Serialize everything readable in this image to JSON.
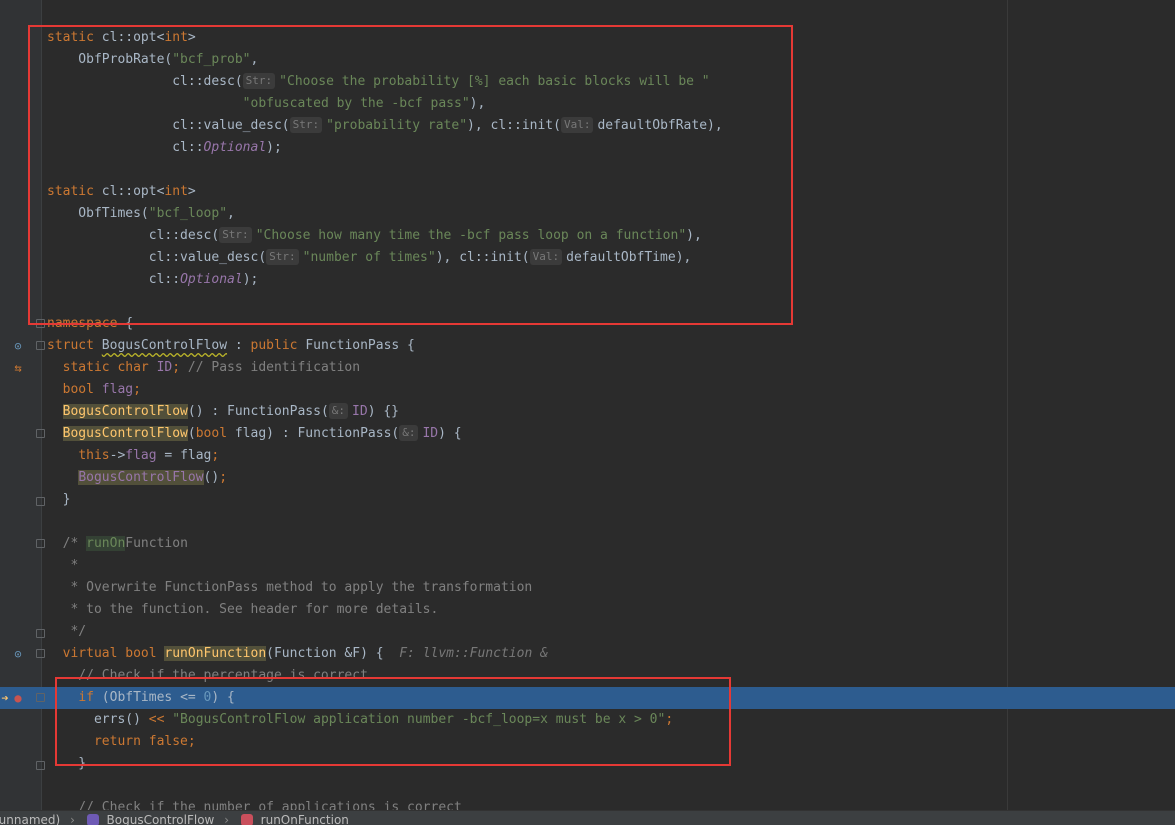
{
  "editor": {
    "lines": [
      {
        "id": "l1",
        "tokens": [
          {
            "c": "kw",
            "t": "static "
          },
          {
            "t": "cl::opt<"
          },
          {
            "c": "kw",
            "t": "int"
          },
          {
            "t": ">"
          }
        ]
      },
      {
        "id": "l2",
        "tokens": [
          {
            "t": "    ObfProbRate("
          },
          {
            "c": "str",
            "t": "\"bcf_prob\""
          },
          {
            "t": ","
          }
        ]
      },
      {
        "id": "l3",
        "tokens": [
          {
            "t": "                cl::desc("
          },
          {
            "c": "hint",
            "t": "Str:"
          },
          {
            "c": "str",
            "t": "\"Choose the probability [%] each basic blocks will be \""
          }
        ]
      },
      {
        "id": "l4",
        "tokens": [
          {
            "t": "                         "
          },
          {
            "c": "str",
            "t": "\"obfuscated by the -bcf pass\""
          },
          {
            "t": "),"
          }
        ]
      },
      {
        "id": "l5",
        "tokens": [
          {
            "t": "                cl::value_desc("
          },
          {
            "c": "hint",
            "t": "Str:"
          },
          {
            "c": "str",
            "t": "\"probability rate\""
          },
          {
            "t": "), cl::init("
          },
          {
            "c": "hint",
            "t": "Val:"
          },
          {
            "t": "defaultObfRate),"
          }
        ]
      },
      {
        "id": "l6",
        "tokens": [
          {
            "t": "                cl::"
          },
          {
            "c": "ital",
            "t": "Optional"
          },
          {
            "t": ");"
          }
        ]
      },
      {
        "id": "l7",
        "tokens": []
      },
      {
        "id": "l8",
        "tokens": [
          {
            "c": "kw",
            "t": "static "
          },
          {
            "t": "cl::opt<"
          },
          {
            "c": "kw",
            "t": "int"
          },
          {
            "t": ">"
          }
        ]
      },
      {
        "id": "l9",
        "tokens": [
          {
            "t": "    ObfTimes("
          },
          {
            "c": "str",
            "t": "\"bcf_loop\""
          },
          {
            "t": ","
          }
        ]
      },
      {
        "id": "l10",
        "tokens": [
          {
            "t": "             cl::desc("
          },
          {
            "c": "hint",
            "t": "Str:"
          },
          {
            "c": "str",
            "t": "\"Choose how many time the -bcf pass loop on a function\""
          },
          {
            "t": "),"
          }
        ]
      },
      {
        "id": "l11",
        "tokens": [
          {
            "t": "             cl::value_desc("
          },
          {
            "c": "hint",
            "t": "Str:"
          },
          {
            "c": "str",
            "t": "\"number of times\""
          },
          {
            "t": "), cl::init("
          },
          {
            "c": "hint",
            "t": "Val:"
          },
          {
            "t": "defaultObfTime),"
          }
        ]
      },
      {
        "id": "l12",
        "tokens": [
          {
            "t": "             cl::"
          },
          {
            "c": "ital",
            "t": "Optional"
          },
          {
            "t": ");"
          }
        ]
      },
      {
        "id": "l13",
        "tokens": []
      },
      {
        "id": "l14",
        "fold": "start",
        "tokens": [
          {
            "c": "kw",
            "t": "namespace "
          },
          {
            "t": "{"
          }
        ]
      },
      {
        "id": "l15",
        "fold": "start",
        "icon": "override",
        "tokens": [
          {
            "c": "kw",
            "t": "struct "
          },
          {
            "c": "squiggle",
            "t": "BogusControlFlow"
          },
          {
            "t": " : "
          },
          {
            "c": "kw",
            "t": "public "
          },
          {
            "t": "FunctionPass {"
          }
        ]
      },
      {
        "id": "l16",
        "icon": "related",
        "tokens": [
          {
            "t": "  "
          },
          {
            "c": "kw",
            "t": "static char "
          },
          {
            "c": "fld",
            "t": "ID"
          },
          {
            "c": "kw",
            "t": "; "
          },
          {
            "c": "cmt",
            "t": "// Pass identification"
          }
        ]
      },
      {
        "id": "l17",
        "tokens": [
          {
            "t": "  "
          },
          {
            "c": "kw",
            "t": "bool "
          },
          {
            "c": "fld",
            "t": "flag"
          },
          {
            "c": "kw",
            "t": ";"
          }
        ]
      },
      {
        "id": "l18",
        "tokens": [
          {
            "t": "  "
          },
          {
            "c": "fn hl-ident",
            "t": "BogusControlFlow"
          },
          {
            "t": "() : FunctionPass("
          },
          {
            "c": "hint",
            "t": "&:"
          },
          {
            "c": "fld",
            "t": "ID"
          },
          {
            "t": ") {}"
          }
        ]
      },
      {
        "id": "l19",
        "fold": "start",
        "tokens": [
          {
            "t": "  "
          },
          {
            "c": "fn hl-ident",
            "t": "BogusControlFlow"
          },
          {
            "t": "("
          },
          {
            "c": "kw",
            "t": "bool "
          },
          {
            "t": "flag) : FunctionPass("
          },
          {
            "c": "hint",
            "t": "&:"
          },
          {
            "c": "fld",
            "t": "ID"
          },
          {
            "t": ") {"
          }
        ]
      },
      {
        "id": "l20",
        "tokens": [
          {
            "t": "    "
          },
          {
            "c": "kw",
            "t": "this"
          },
          {
            "t": "->"
          },
          {
            "c": "fld",
            "t": "flag"
          },
          {
            "t": " = flag"
          },
          {
            "c": "kw",
            "t": ";"
          }
        ]
      },
      {
        "id": "l21",
        "tokens": [
          {
            "t": "    "
          },
          {
            "c": "fld hl-ident",
            "t": "BogusControlFlow"
          },
          {
            "t": "()"
          },
          {
            "c": "kw",
            "t": ";"
          }
        ]
      },
      {
        "id": "l22",
        "fold": "end",
        "tokens": [
          {
            "t": "  }"
          }
        ]
      },
      {
        "id": "l23",
        "tokens": []
      },
      {
        "id": "l24",
        "fold": "start",
        "tokens": [
          {
            "t": "  "
          },
          {
            "c": "cmt",
            "t": "/* "
          },
          {
            "c": "str hl-green",
            "t": "runOn"
          },
          {
            "c": "cmt",
            "t": "Function"
          }
        ]
      },
      {
        "id": "l25",
        "tokens": [
          {
            "c": "cmt",
            "t": "   *"
          }
        ]
      },
      {
        "id": "l26",
        "tokens": [
          {
            "c": "cmt",
            "t": "   * Overwrite FunctionPass method to apply the transformation"
          }
        ]
      },
      {
        "id": "l27",
        "tokens": [
          {
            "c": "cmt",
            "t": "   * to the function. See header for more details."
          }
        ]
      },
      {
        "id": "l28",
        "fold": "end",
        "tokens": [
          {
            "c": "cmt",
            "t": "   */"
          }
        ]
      },
      {
        "id": "l29",
        "fold": "start",
        "icon": "override",
        "tokens": [
          {
            "t": "  "
          },
          {
            "c": "kw",
            "t": "virtual bool "
          },
          {
            "c": "fn hl-ident",
            "t": "runOnFunction"
          },
          {
            "t": "(Function &F) {  "
          },
          {
            "c": "inline-hint",
            "t": "F: llvm::Function &"
          }
        ]
      },
      {
        "id": "l30",
        "tokens": [
          {
            "c": "cmt",
            "t": "    // Check if the percentage is correct"
          }
        ]
      },
      {
        "id": "l31",
        "fold": "start",
        "current": true,
        "icon": "breakpoint",
        "tokens": [
          {
            "t": "    "
          },
          {
            "c": "kw",
            "t": "if "
          },
          {
            "t": "(ObfTimes <= "
          },
          {
            "c": "num",
            "t": "0"
          },
          {
            "t": ") {"
          }
        ]
      },
      {
        "id": "l32",
        "tokens": [
          {
            "t": "      errs() "
          },
          {
            "c": "kw",
            "t": "<< "
          },
          {
            "c": "str",
            "t": "\"BogusControlFlow application number -bcf_loop=x must be x > 0\""
          },
          {
            "c": "kw",
            "t": ";"
          }
        ]
      },
      {
        "id": "l33",
        "tokens": [
          {
            "t": "      "
          },
          {
            "c": "kw",
            "t": "return false;"
          }
        ]
      },
      {
        "id": "l34",
        "fold": "end",
        "tokens": [
          {
            "t": "    }"
          }
        ]
      },
      {
        "id": "l35",
        "tokens": []
      },
      {
        "id": "l36",
        "tokens": [
          {
            "c": "cmt",
            "t": "    // Check if the number of applications is correct"
          }
        ]
      }
    ]
  },
  "breadcrumb": {
    "namespace": "(unnamed)",
    "struct": "BogusControlFlow",
    "method": "runOnFunction"
  },
  "colors": {
    "background": "#2b2b2b",
    "keyword": "#cc7832",
    "string": "#6a8759",
    "current_line": "#2d5c8f",
    "annotation_box": "#e53935"
  }
}
